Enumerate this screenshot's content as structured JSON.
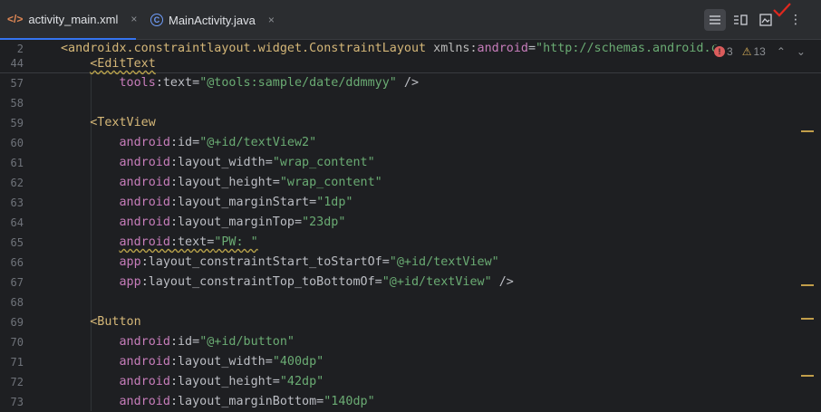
{
  "tabs": [
    {
      "label": "activity_main.xml",
      "icon": "xml-file-icon",
      "close": "×"
    },
    {
      "label": "MainActivity.java",
      "icon": "java-class-icon",
      "close": "×"
    }
  ],
  "toolbar": {
    "code_view": "code-view-icon",
    "split_view": "split-view-icon",
    "design_view": "design-view-icon",
    "more": "⋮"
  },
  "inspections": {
    "errors": "3",
    "warnings": "13"
  },
  "sticky_lines": [
    {
      "num": "2",
      "parts": [
        {
          "c": "t",
          "v": "<androidx.constraintlayout.widget.ConstraintLayout "
        },
        {
          "c": "at",
          "v": "xmlns:"
        },
        {
          "c": "a",
          "v": "android"
        },
        {
          "c": "p",
          "v": "="
        },
        {
          "c": "s",
          "v": "\"http://schemas.android.c"
        }
      ]
    },
    {
      "num": "44",
      "parts": [
        {
          "c": "p",
          "v": "    "
        },
        {
          "c": "t",
          "v": "<EditText"
        }
      ]
    }
  ],
  "lines": [
    {
      "num": "57",
      "parts": [
        {
          "c": "p",
          "v": "        "
        },
        {
          "c": "a",
          "v": "tools"
        },
        {
          "c": "p",
          "v": ":text="
        },
        {
          "c": "s",
          "v": "\"@tools:sample/date/ddmmyy\""
        },
        {
          "c": "p",
          "v": " />"
        }
      ]
    },
    {
      "num": "58",
      "parts": []
    },
    {
      "num": "59",
      "parts": [
        {
          "c": "p",
          "v": "    "
        },
        {
          "c": "t",
          "v": "<TextView"
        }
      ]
    },
    {
      "num": "60",
      "parts": [
        {
          "c": "p",
          "v": "        "
        },
        {
          "c": "a",
          "v": "android"
        },
        {
          "c": "p",
          "v": ":id="
        },
        {
          "c": "s",
          "v": "\"@+id/textView2\""
        }
      ]
    },
    {
      "num": "61",
      "parts": [
        {
          "c": "p",
          "v": "        "
        },
        {
          "c": "a",
          "v": "android"
        },
        {
          "c": "p",
          "v": ":layout_width="
        },
        {
          "c": "s",
          "v": "\"wrap_content\""
        }
      ]
    },
    {
      "num": "62",
      "parts": [
        {
          "c": "p",
          "v": "        "
        },
        {
          "c": "a",
          "v": "android"
        },
        {
          "c": "p",
          "v": ":layout_height="
        },
        {
          "c": "s",
          "v": "\"wrap_content\""
        }
      ]
    },
    {
      "num": "63",
      "parts": [
        {
          "c": "p",
          "v": "        "
        },
        {
          "c": "a",
          "v": "android"
        },
        {
          "c": "p",
          "v": ":layout_marginStart="
        },
        {
          "c": "s",
          "v": "\"1dp\""
        }
      ]
    },
    {
      "num": "64",
      "parts": [
        {
          "c": "p",
          "v": "        "
        },
        {
          "c": "a",
          "v": "android"
        },
        {
          "c": "p",
          "v": ":layout_marginTop="
        },
        {
          "c": "s",
          "v": "\"23dp\""
        }
      ]
    },
    {
      "num": "65",
      "parts": [
        {
          "c": "p",
          "v": "        "
        },
        {
          "c": "a",
          "v": "android"
        },
        {
          "c": "p",
          "v": ":text="
        },
        {
          "c": "s",
          "v": "\"PW: \""
        }
      ]
    },
    {
      "num": "66",
      "parts": [
        {
          "c": "p",
          "v": "        "
        },
        {
          "c": "a",
          "v": "app"
        },
        {
          "c": "p",
          "v": ":layout_constraintStart_toStartOf="
        },
        {
          "c": "s",
          "v": "\"@+id/textView\""
        }
      ]
    },
    {
      "num": "67",
      "parts": [
        {
          "c": "p",
          "v": "        "
        },
        {
          "c": "a",
          "v": "app"
        },
        {
          "c": "p",
          "v": ":layout_constraintTop_toBottomOf="
        },
        {
          "c": "s",
          "v": "\"@+id/textView\""
        },
        {
          "c": "p",
          "v": " />"
        }
      ]
    },
    {
      "num": "68",
      "parts": []
    },
    {
      "num": "69",
      "parts": [
        {
          "c": "p",
          "v": "    "
        },
        {
          "c": "t",
          "v": "<Button"
        }
      ]
    },
    {
      "num": "70",
      "parts": [
        {
          "c": "p",
          "v": "        "
        },
        {
          "c": "a",
          "v": "android"
        },
        {
          "c": "p",
          "v": ":id="
        },
        {
          "c": "s",
          "v": "\"@+id/button\""
        }
      ]
    },
    {
      "num": "71",
      "parts": [
        {
          "c": "p",
          "v": "        "
        },
        {
          "c": "a",
          "v": "android"
        },
        {
          "c": "p",
          "v": ":layout_width="
        },
        {
          "c": "s",
          "v": "\"400dp\""
        }
      ]
    },
    {
      "num": "72",
      "parts": [
        {
          "c": "p",
          "v": "        "
        },
        {
          "c": "a",
          "v": "android"
        },
        {
          "c": "p",
          "v": ":layout_height="
        },
        {
          "c": "s",
          "v": "\"42dp\""
        }
      ]
    },
    {
      "num": "73",
      "parts": [
        {
          "c": "p",
          "v": "        "
        },
        {
          "c": "a",
          "v": "android"
        },
        {
          "c": "p",
          "v": ":layout_marginBottom="
        },
        {
          "c": "s",
          "v": "\"140dp\""
        }
      ]
    }
  ],
  "colors": {
    "accent": "#3574f0",
    "tag": "#d5b778",
    "attr_ns": "#c77dbb",
    "string": "#6aab73",
    "warning": "#c29e4a",
    "error": "#db5c5c"
  }
}
